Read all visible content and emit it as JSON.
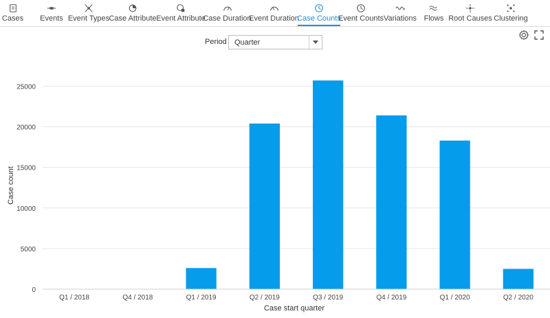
{
  "tabs": [
    {
      "label": "Cases",
      "icon": "cases-icon",
      "active": false
    },
    {
      "label": "Events",
      "icon": "events-icon",
      "active": false
    },
    {
      "label": "Event Types",
      "icon": "event-types-icon",
      "active": false
    },
    {
      "label": "Case Attribute",
      "icon": "case-attribute-icon",
      "active": false
    },
    {
      "label": "Event Attribute",
      "icon": "event-attribute-icon",
      "active": false
    },
    {
      "label": "Case Duration",
      "icon": "case-duration-icon",
      "active": false
    },
    {
      "label": "Event Duration",
      "icon": "event-duration-icon",
      "active": false
    },
    {
      "label": "Case Counts",
      "icon": "case-counts-icon",
      "active": true
    },
    {
      "label": "Event Counts",
      "icon": "event-counts-icon",
      "active": false
    },
    {
      "label": "Variations",
      "icon": "variations-icon",
      "active": false
    },
    {
      "label": "Flows",
      "icon": "flows-icon",
      "active": false
    },
    {
      "label": "Root Causes",
      "icon": "root-causes-icon",
      "active": false
    },
    {
      "label": "Clustering",
      "icon": "clustering-icon",
      "active": false
    }
  ],
  "toolbar": {
    "settings_icon": "gear-icon",
    "fullscreen_icon": "fullscreen-icon"
  },
  "period": {
    "label": "Period",
    "value": "Quarter"
  },
  "colors": {
    "accent": "#1e90e6",
    "bar": "#069cec"
  },
  "chart_data": {
    "type": "bar",
    "categories": [
      "Q1 / 2018",
      "Q4 / 2018",
      "Q1 / 2019",
      "Q2 / 2019",
      "Q3 / 2019",
      "Q4 / 2019",
      "Q1 / 2020",
      "Q2 / 2020"
    ],
    "values": [
      0,
      0,
      2600,
      20400,
      25700,
      21400,
      18300,
      2500
    ],
    "xlabel": "Case start quarter",
    "ylabel": "Case count",
    "ylim": [
      0,
      28000
    ],
    "yticks": [
      0,
      5000,
      10000,
      15000,
      20000,
      25000
    ],
    "grid": true
  }
}
